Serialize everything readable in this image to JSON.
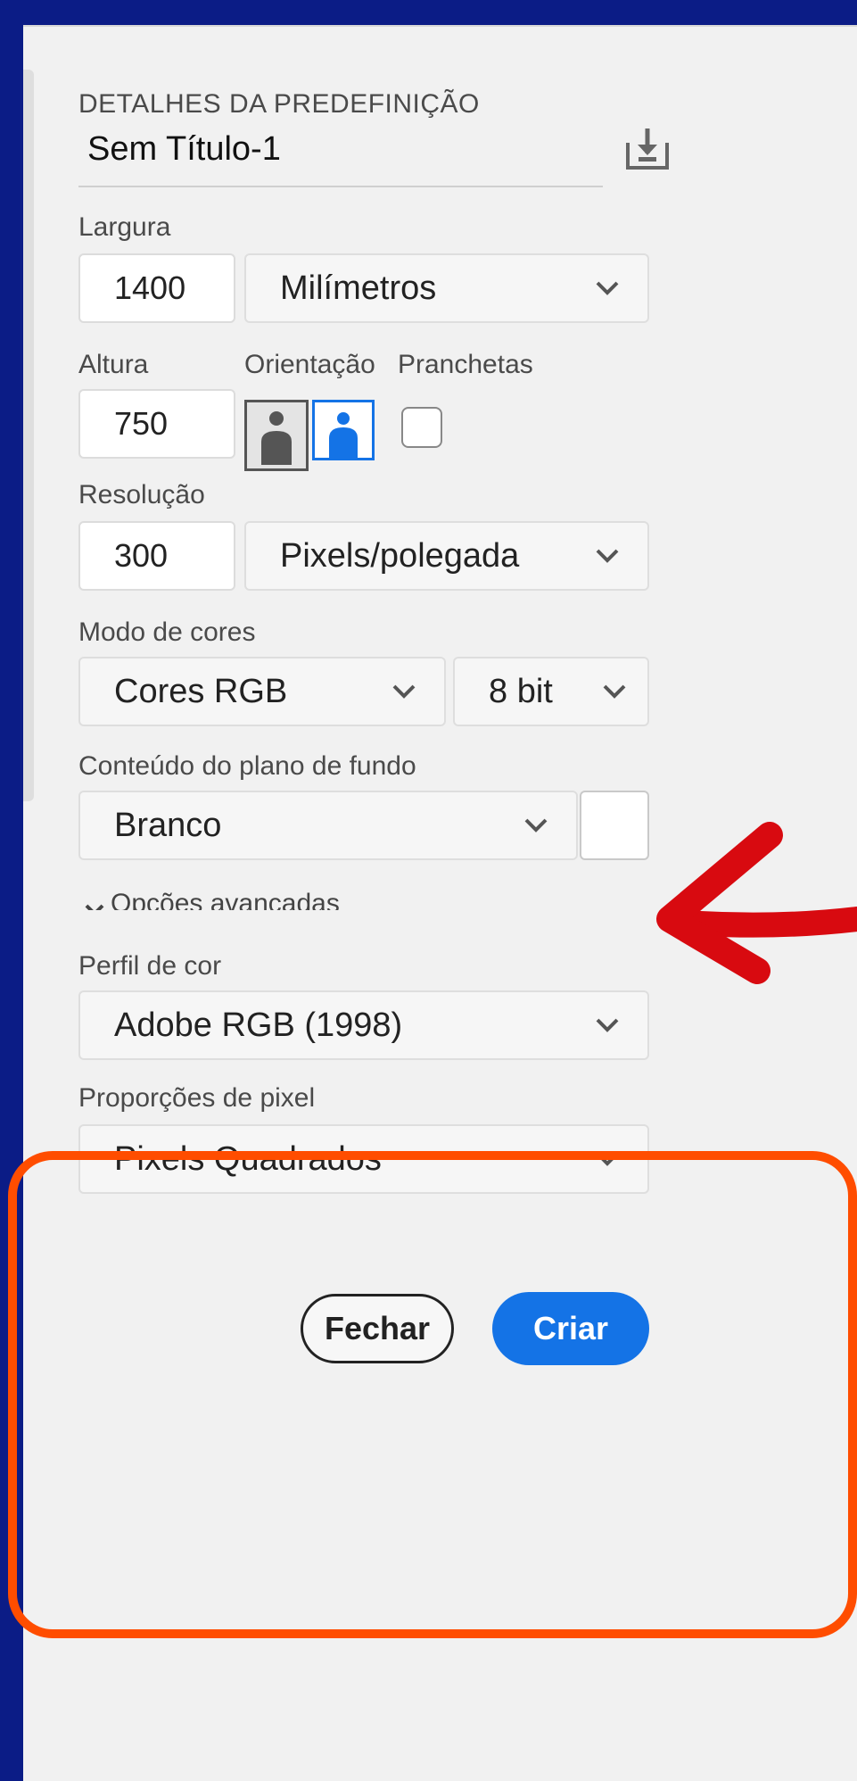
{
  "panel": {
    "section_title": "DETALHES DA PREDEFINIÇÃO",
    "preset_name": "Sem Título-1",
    "save_preset_icon": "save-preset-icon"
  },
  "width": {
    "label": "Largura",
    "value": "1400",
    "unit": "Milímetros"
  },
  "height": {
    "label": "Altura",
    "value": "750"
  },
  "orientation": {
    "label": "Orientação",
    "selected": "landscape"
  },
  "artboards": {
    "label": "Pranchetas",
    "checked": false
  },
  "resolution": {
    "label": "Resolução",
    "value": "300",
    "unit": "Pixels/polegada"
  },
  "color_mode": {
    "label": "Modo de cores",
    "value": "Cores RGB",
    "depth": "8 bit"
  },
  "background": {
    "label": "Conteúdo do plano de fundo",
    "value": "Branco",
    "swatch_color": "#ffffff"
  },
  "advanced": {
    "toggle_label": "Opções avançadas",
    "color_profile": {
      "label": "Perfil de cor",
      "value": "Adobe RGB (1998)"
    },
    "pixel_aspect": {
      "label": "Proporções de pixel",
      "value": "Pixels Quadrados"
    }
  },
  "buttons": {
    "close": "Fechar",
    "create": "Criar"
  },
  "colors": {
    "frame": "#0b1c86",
    "highlight": "#ff4d00",
    "arrow": "#d80a10",
    "accent": "#1473e6"
  }
}
